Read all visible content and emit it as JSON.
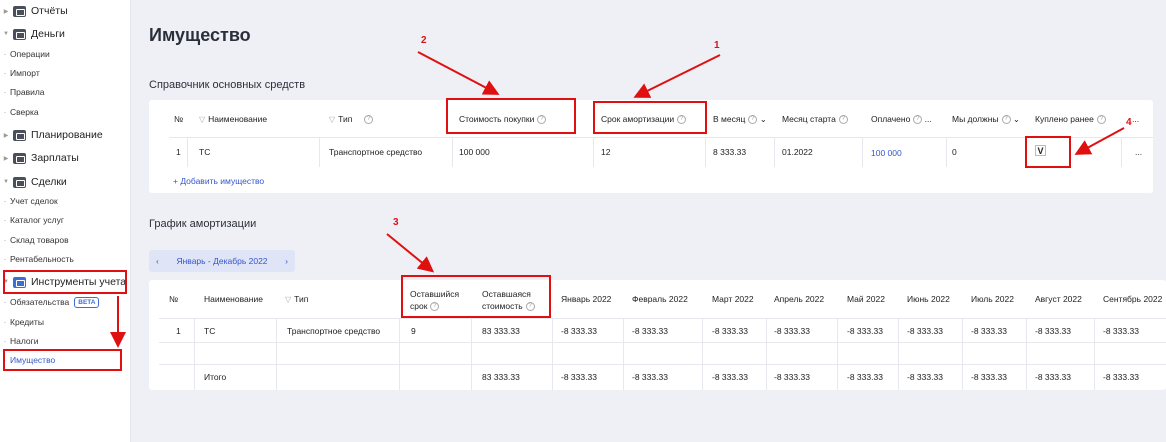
{
  "sidebar": {
    "reports": "Отчёты",
    "money": "Деньги",
    "operations": "Операции",
    "import": "Импорт",
    "rules": "Правила",
    "reconciliation": "Сверка",
    "planning": "Планирование",
    "salaries": "Зарплаты",
    "deals": "Сделки",
    "deal_accounting": "Учет сделок",
    "services_catalog": "Каталог услуг",
    "warehouse": "Склад товаров",
    "profitability": "Рентабельность",
    "accounting_tools": "Инструменты учета",
    "obligations": "Обязательства",
    "beta": "BETA",
    "credits": "Кредиты",
    "taxes": "Налоги",
    "property": "Имущество"
  },
  "page": {
    "title": "Имущество"
  },
  "assets": {
    "section_title": "Справочник основных средств",
    "headers": {
      "num": "№",
      "name": "Наименование",
      "type": "Тип",
      "purchase_cost": "Стоимость покупки",
      "depreciation_period": "Срок амортизации",
      "per_month": "В месяц",
      "start_month": "Месяц старта",
      "paid": "Оплачено",
      "we_owe": "Мы должны",
      "bought_before": "Куплено ранее",
      "more": "..."
    },
    "rows": [
      {
        "num": "1",
        "name": "ТС",
        "type": "Транспортное средство",
        "purchase_cost": "100 000",
        "depreciation_period": "12",
        "per_month": "8 333.33",
        "start_month": "01.2022",
        "paid": "100 000",
        "we_owe": "0",
        "bought_before": "V",
        "more": "..."
      }
    ],
    "add_link": "+ Добавить имущество"
  },
  "schedule": {
    "section_title": "График амортизации",
    "period_label": "Январь - Декабрь 2022",
    "headers": {
      "num": "№",
      "name": "Наименование",
      "type": "Тип",
      "remaining_term_1": "Оставшийся",
      "remaining_term_2": "срок",
      "remaining_value_1": "Оставшаяся",
      "remaining_value_2": "стоимость",
      "months": [
        "Январь 2022",
        "Февраль 2022",
        "Март 2022",
        "Апрель 2022",
        "Май 2022",
        "Июнь 2022",
        "Июль 2022",
        "Август 2022",
        "Сентябрь 2022"
      ]
    },
    "rows": [
      {
        "num": "1",
        "name": "ТС",
        "type": "Транспортное средство",
        "remaining_term": "9",
        "remaining_value": "83 333.33",
        "months": [
          "-8 333.33",
          "-8 333.33",
          "-8 333.33",
          "-8 333.33",
          "-8 333.33",
          "-8 333.33",
          "-8 333.33",
          "-8 333.33",
          "-8 333.33"
        ]
      }
    ],
    "total": {
      "label": "Итого",
      "remaining_value": "83 333.33",
      "months": [
        "-8 333.33",
        "-8 333.33",
        "-8 333.33",
        "-8 333.33",
        "-8 333.33",
        "-8 333.33",
        "-8 333.33",
        "-8 333.33",
        "-8 333.33"
      ]
    }
  },
  "annotations": {
    "n1": "1",
    "n2": "2",
    "n3": "3",
    "n4": "4"
  },
  "colors": {
    "accent": "#3557c8",
    "annotation": "#e01010"
  }
}
